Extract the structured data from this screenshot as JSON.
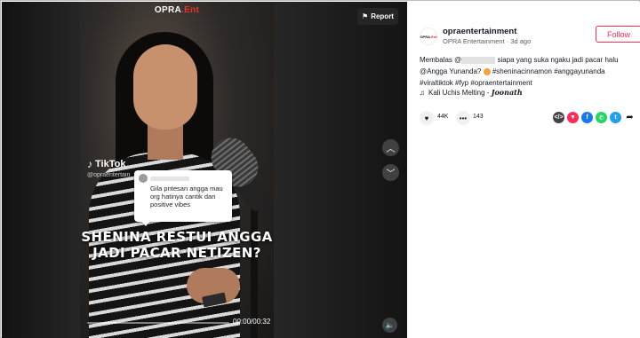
{
  "video": {
    "brand_logo": "OPRA",
    "brand_logo_accent": ".Ent",
    "report_label": "Report",
    "report_icon": "flag-icon",
    "tiktok_logo": "TikTok",
    "tiktok_handle": "@opraentertain",
    "comment": {
      "text": "Gila pntesan angga mau org hatinya cantik dan positive vibes"
    },
    "headline": "SHENINA RESTUI ANGGA JADI PACAR NETIZEN?",
    "time": "00:00/00:32",
    "progress": 0.0,
    "prev_icon": "chevron-up-icon",
    "next_icon": "chevron-down-icon",
    "volume_icon": "speaker-icon"
  },
  "account": {
    "avatar_text": "OPRA",
    "avatar_accent": ".Ent",
    "username": "opraentertainment",
    "display_name": "OPRA Entertainment",
    "separator": "·",
    "posted": "3d ago",
    "follow_label": "Follow"
  },
  "caption": {
    "prefix": "Membalas @",
    "line1_rest": " siapa yang suka ngaku jadi pacar halu",
    "line2_start": "@Angga Yunanda? ",
    "line2_tags": " #sheninacinnamon #anggayunanda",
    "line3": "#viraltiktok #fyp #opraentertainment"
  },
  "music": {
    "icon": "music-note-icon",
    "title": "Kali Uchis Melting - ",
    "signature": "Joonath"
  },
  "stats": {
    "likes": "44K",
    "comments": "143"
  },
  "colors": {
    "accent": "#fe2c55",
    "brand_red": "#e8302f",
    "facebook": "#1877f2",
    "whatsapp": "#25d366",
    "twitter": "#1da1f2"
  }
}
